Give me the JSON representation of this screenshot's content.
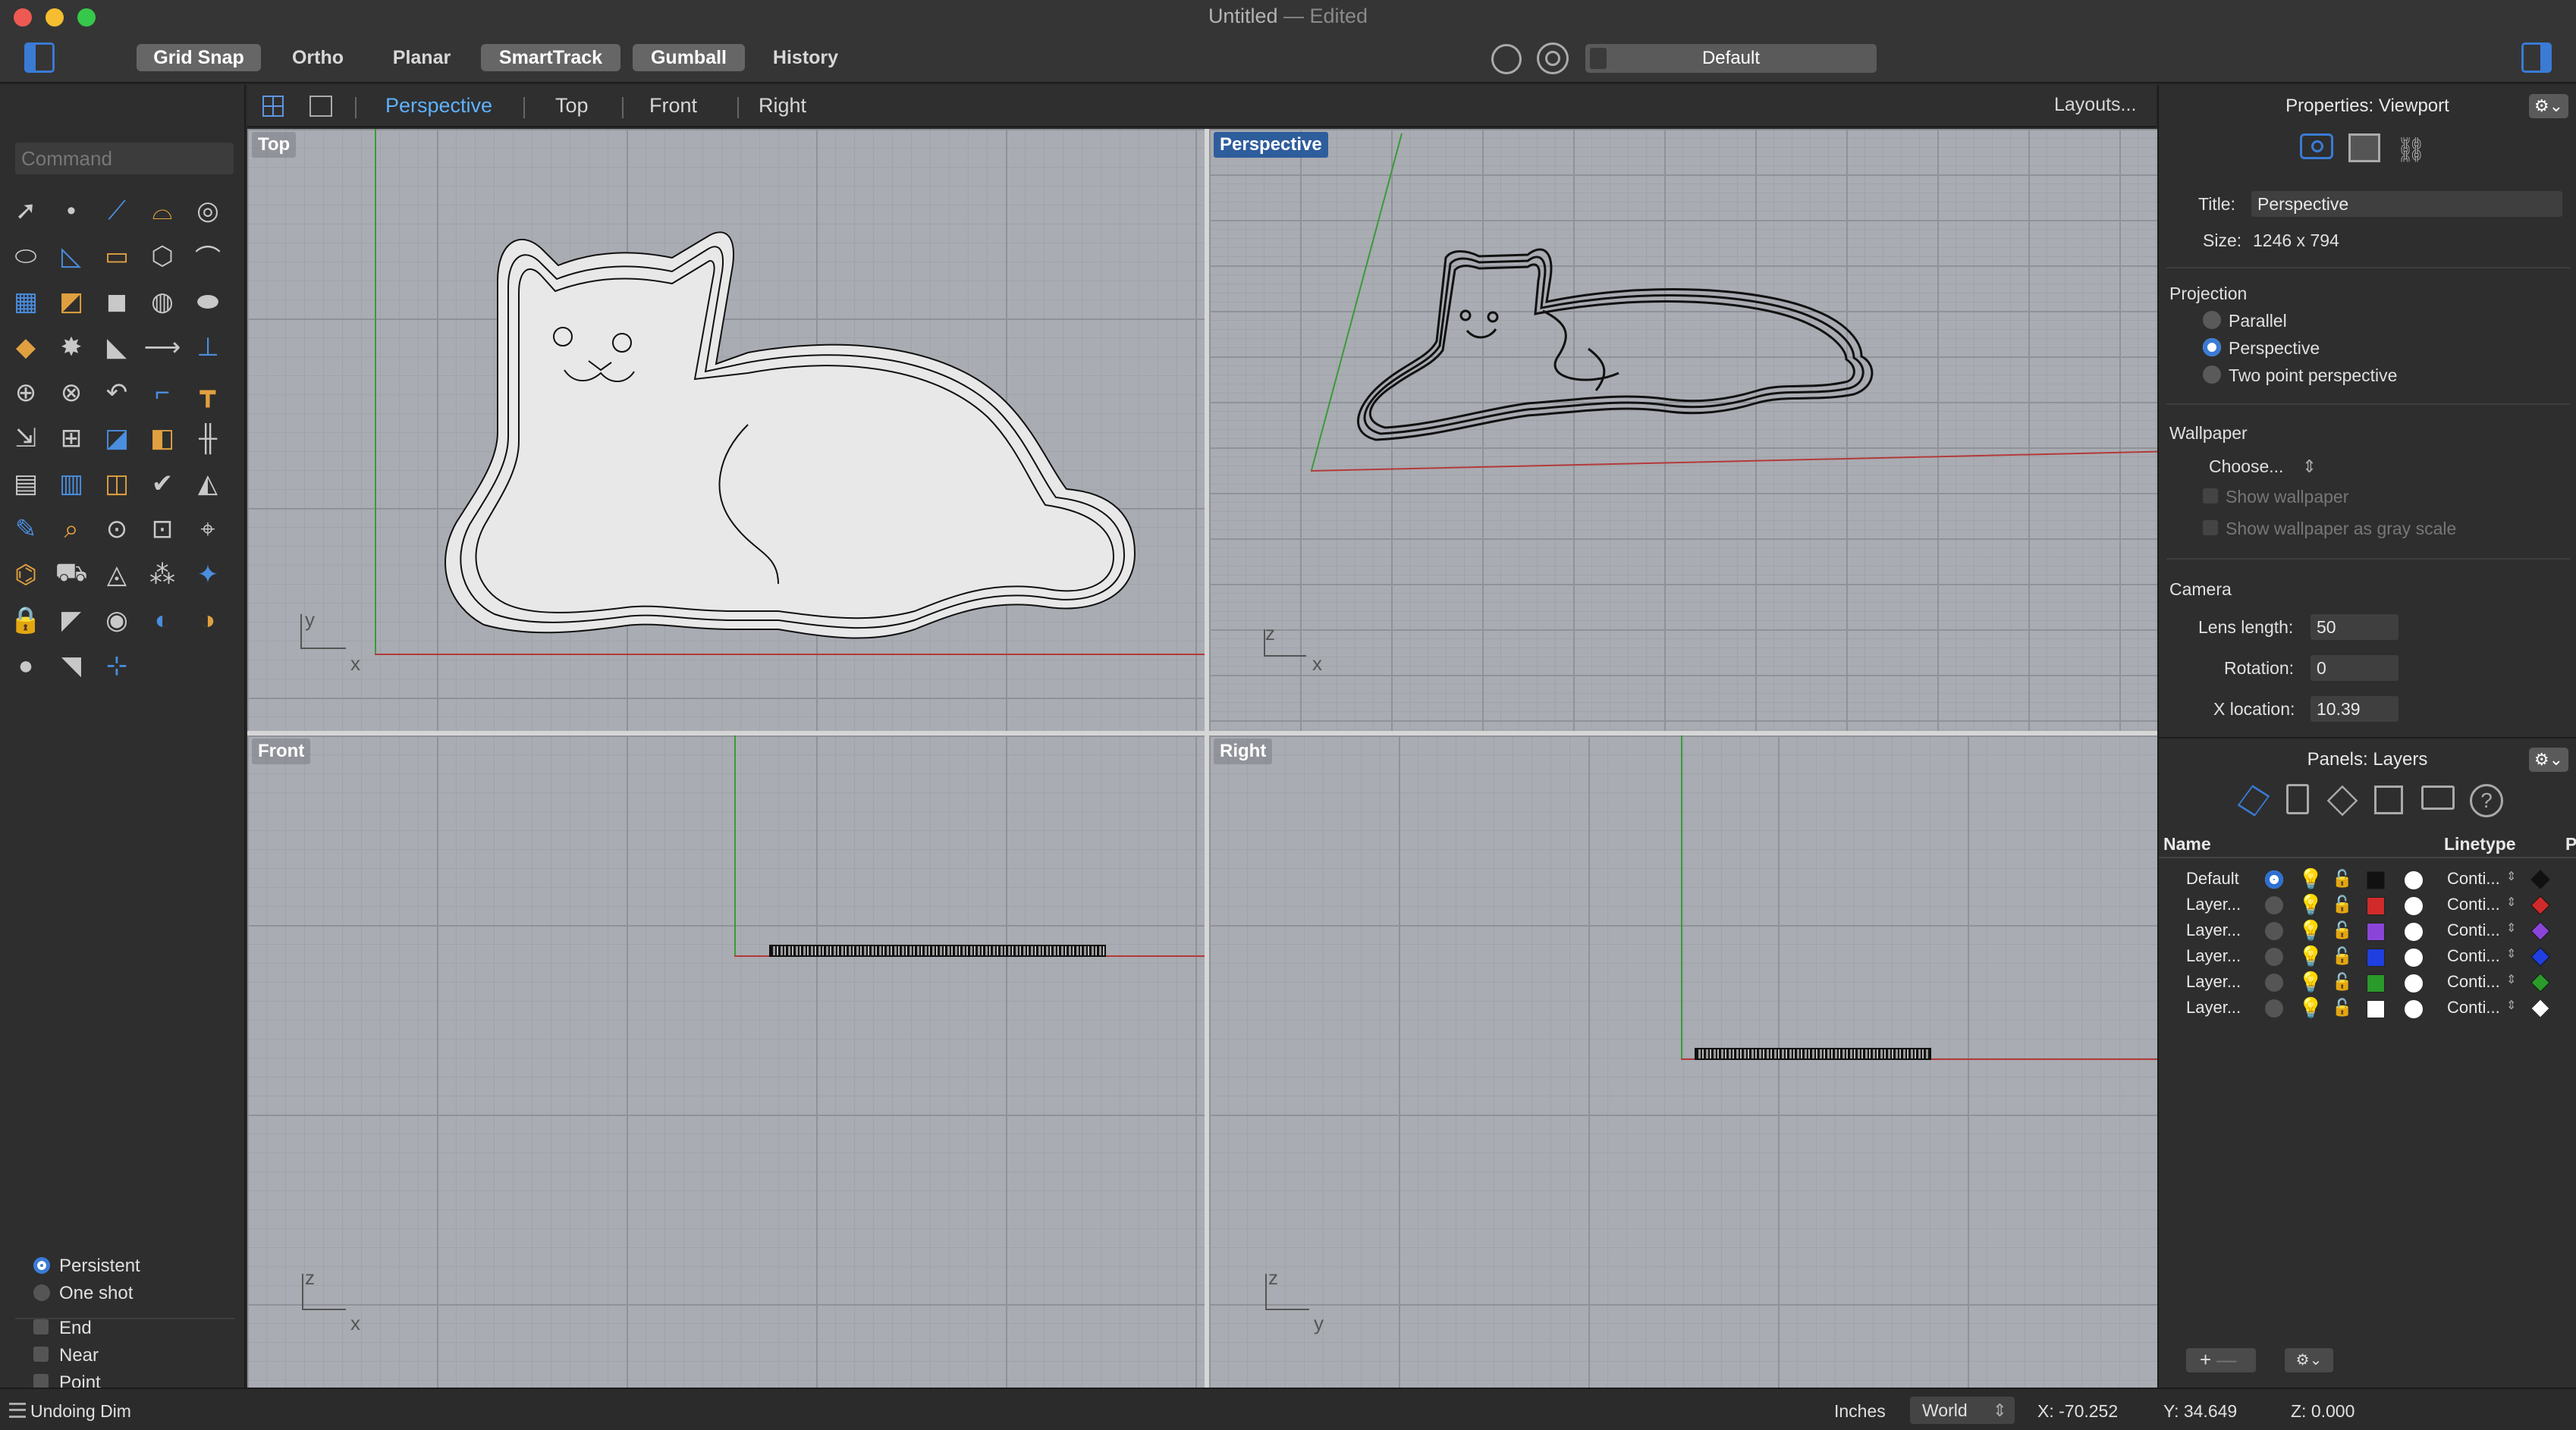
{
  "window": {
    "title": "Untitled",
    "title_suffix": "— Edited"
  },
  "toolbar": {
    "toggles": [
      {
        "label": "Grid Snap",
        "on": true
      },
      {
        "label": "Ortho",
        "on": false
      },
      {
        "label": "Planar",
        "on": false
      },
      {
        "label": "SmartTrack",
        "on": true
      },
      {
        "label": "Gumball",
        "on": true
      },
      {
        "label": "History",
        "on": false
      }
    ],
    "display_mode": "Default"
  },
  "command": {
    "placeholder": "Command"
  },
  "osnap": {
    "mode_persistent": "Persistent",
    "mode_oneshot": "One shot",
    "end": "End",
    "near": "Near",
    "point": "Point"
  },
  "viewport_tabs": {
    "tabs": [
      "Perspective",
      "Top",
      "Front",
      "Right"
    ],
    "active": "Perspective",
    "layouts": "Layouts..."
  },
  "viewports": {
    "top": {
      "label": "Top",
      "axis_a": "y",
      "axis_b": "x"
    },
    "perspective": {
      "label": "Perspective",
      "axis_a": "z",
      "axis_b": "x"
    },
    "front": {
      "label": "Front",
      "axis_a": "z",
      "axis_b": "x"
    },
    "right": {
      "label": "Right",
      "axis_a": "z",
      "axis_b": "y"
    }
  },
  "properties": {
    "title": "Properties: Viewport",
    "gear": "⚙︎⌄",
    "title_label": "Title:",
    "title_value": "Perspective",
    "size_label": "Size:",
    "size_value": "1246 x 794",
    "projection_label": "Projection",
    "proj_parallel": "Parallel",
    "proj_perspective": "Perspective",
    "proj_two_point": "Two point perspective",
    "wallpaper_label": "Wallpaper",
    "wallpaper_choose": "Choose...",
    "show_wallpaper": "Show wallpaper",
    "show_wallpaper_gray": "Show wallpaper as gray scale",
    "camera_label": "Camera",
    "lens_label": "Lens length:",
    "lens_value": "50",
    "rotation_label": "Rotation:",
    "rotation_value": "0",
    "xloc_label": "X location:",
    "xloc_value": "10.39"
  },
  "layers": {
    "title": "Panels: Layers",
    "gear": "⚙︎⌄",
    "col_name": "Name",
    "col_linetype": "Linetype",
    "col_p": "P",
    "rows": [
      {
        "name": "Default",
        "current": true,
        "color": "#111111",
        "linetype": "Conti...",
        "pcolor": "#111111"
      },
      {
        "name": "Layer...",
        "current": false,
        "color": "#d12a2a",
        "linetype": "Conti...",
        "pcolor": "#d12a2a"
      },
      {
        "name": "Layer...",
        "current": false,
        "color": "#8a45d8",
        "linetype": "Conti...",
        "pcolor": "#8a45d8"
      },
      {
        "name": "Layer...",
        "current": false,
        "color": "#1f3fe0",
        "linetype": "Conti...",
        "pcolor": "#1f3fe0"
      },
      {
        "name": "Layer...",
        "current": false,
        "color": "#2a9a2a",
        "linetype": "Conti...",
        "pcolor": "#2a9a2a"
      },
      {
        "name": "Layer...",
        "current": false,
        "color": "#ffffff",
        "linetype": "Conti...",
        "pcolor": "#ffffff"
      }
    ]
  },
  "status": {
    "message": "Undoing Dim",
    "units": "Inches",
    "cplane": "World",
    "x": "X: -70.252",
    "y": "Y: 34.649",
    "z": "Z: 0.000"
  },
  "colors": {
    "accent": "#3a7bd5",
    "axis_x": "#b33a3a",
    "axis_y": "#3a9a3a"
  }
}
